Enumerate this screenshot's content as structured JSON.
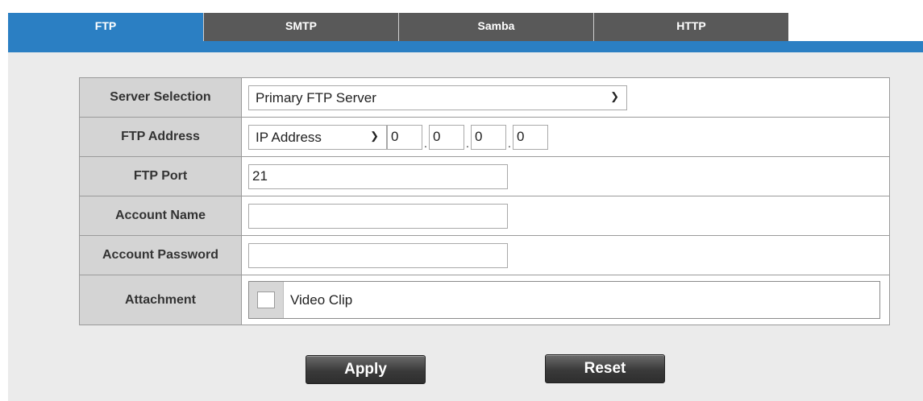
{
  "tabs": [
    {
      "label": "FTP",
      "active": true
    },
    {
      "label": "SMTP",
      "active": false
    },
    {
      "label": "Samba",
      "active": false
    },
    {
      "label": "HTTP",
      "active": false
    }
  ],
  "form": {
    "server_selection": {
      "label": "Server Selection",
      "value": "Primary FTP Server"
    },
    "ftp_address": {
      "label": "FTP Address",
      "type_value": "IP Address",
      "octets": [
        "0",
        "0",
        "0",
        "0"
      ]
    },
    "ftp_port": {
      "label": "FTP Port",
      "value": "21"
    },
    "account_name": {
      "label": "Account Name",
      "value": ""
    },
    "account_password": {
      "label": "Account Password",
      "value": ""
    },
    "attachment": {
      "label": "Attachment",
      "option_label": "Video Clip",
      "checked": false
    }
  },
  "buttons": {
    "apply": "Apply",
    "reset": "Reset"
  },
  "colors": {
    "accent": "#2b7fc3",
    "tab_inactive": "#595959",
    "panel_bg": "#ebebeb",
    "label_bg": "#d4d4d4"
  }
}
